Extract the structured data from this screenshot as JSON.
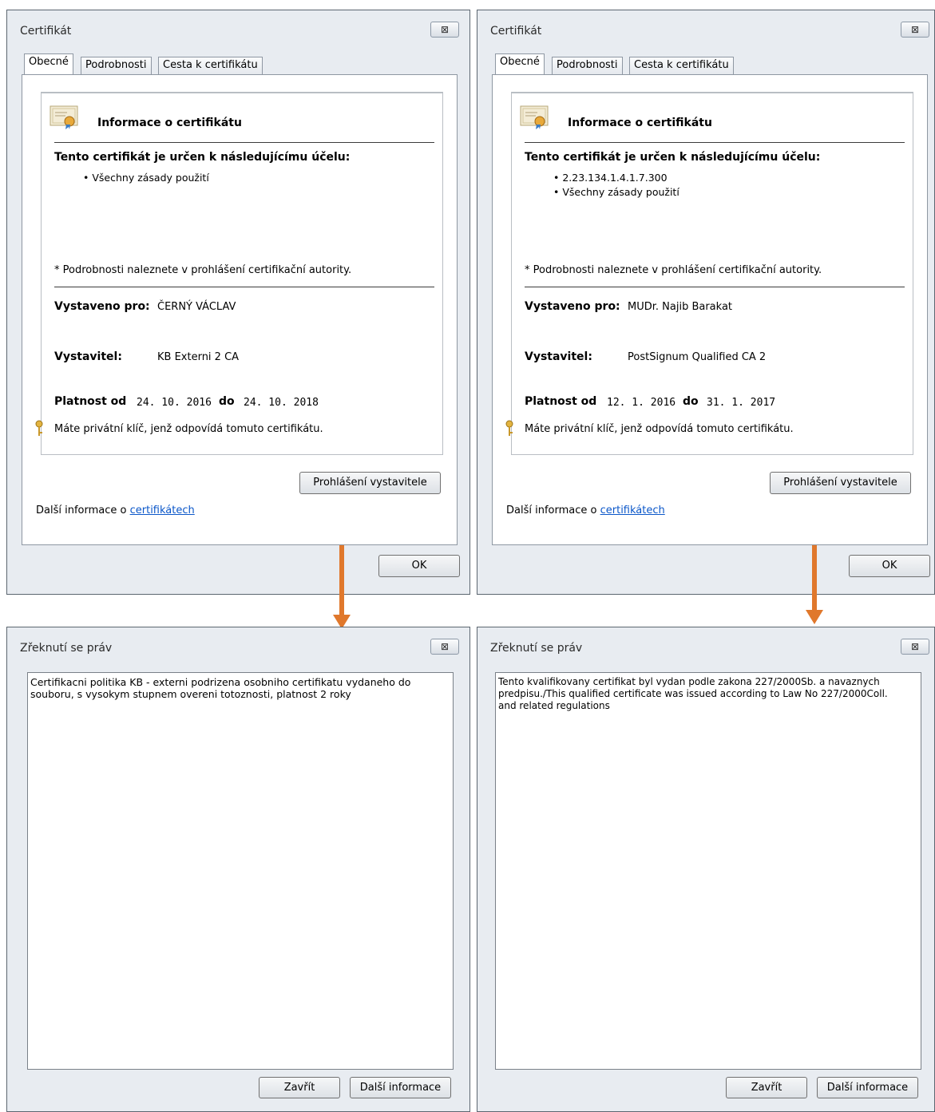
{
  "certificate_dialogs": [
    {
      "title": "Certifikát",
      "close_glyph": "⊠",
      "tabs": [
        "Obecné",
        "Podrobnosti",
        "Cesta k certifikátu"
      ],
      "info_heading": "Informace o certifikátu",
      "purpose_heading": "Tento certifikát je určen k následujícímu účelu:",
      "purposes": [
        "• Všechny zásady použití"
      ],
      "authority_note": "* Podrobnosti naleznete v prohlášení certifikační autority.",
      "issued_to_label": "Vystaveno pro:",
      "issued_to": "ČERNÝ VÁCLAV",
      "issuer_label": "Vystavitel:",
      "issuer": "KB Externi 2 CA",
      "valid_from_label": "Platnost od",
      "valid_from": "24. 10. 2016",
      "valid_to_label": "do",
      "valid_to": "24. 10. 2018",
      "private_key_note": "Máte privátní klíč, jenž odpovídá tomuto certifikátu.",
      "statement_button": "Prohlášení vystavitele",
      "more_info_prefix": "Další informace o ",
      "more_info_link": "certifikátech",
      "ok_button": "OK"
    },
    {
      "title": "Certifikát",
      "close_glyph": "⊠",
      "tabs": [
        "Obecné",
        "Podrobnosti",
        "Cesta k certifikátu"
      ],
      "info_heading": "Informace o certifikátu",
      "purpose_heading": "Tento certifikát je určen k následujícímu účelu:",
      "purposes": [
        "• 2.23.134.1.4.1.7.300",
        "• Všechny zásady použití"
      ],
      "authority_note": "* Podrobnosti naleznete v prohlášení certifikační autority.",
      "issued_to_label": "Vystaveno pro:",
      "issued_to": "MUDr. Najib Barakat",
      "issuer_label": "Vystavitel:",
      "issuer": "PostSignum Qualified CA 2",
      "valid_from_label": "Platnost od",
      "valid_from": "12. 1. 2016",
      "valid_to_label": "do",
      "valid_to": "31. 1. 2017",
      "private_key_note": "Máte privátní klíč, jenž odpovídá tomuto certifikátu.",
      "statement_button": "Prohlášení vystavitele",
      "more_info_prefix": "Další informace o ",
      "more_info_link": "certifikátech",
      "ok_button": "OK"
    }
  ],
  "disclaimer_dialogs": [
    {
      "title": "Zřeknutí se práv",
      "close_glyph": "⊠",
      "text": "Certifikacni politika KB - externi podrizena osobniho certifikatu vydaneho do\nsouboru, s vysokym stupnem overeni totoznosti, platnost 2 roky",
      "close_button": "Zavřít",
      "more_info_button": "Další informace"
    },
    {
      "title": "Zřeknutí se práv",
      "close_glyph": "⊠",
      "text": "Tento kvalifikovany certifikat byl vydan podle zakona 227/2000Sb. a navaznych\npredpisu./This qualified certificate was issued according to Law No 227/2000Coll.\nand related regulations",
      "close_button": "Zavřít",
      "more_info_button": "Další informace"
    }
  ],
  "colors": {
    "arrow": "#e0782c",
    "link": "#0b57c9",
    "window_frame": "#e8ecf1"
  }
}
